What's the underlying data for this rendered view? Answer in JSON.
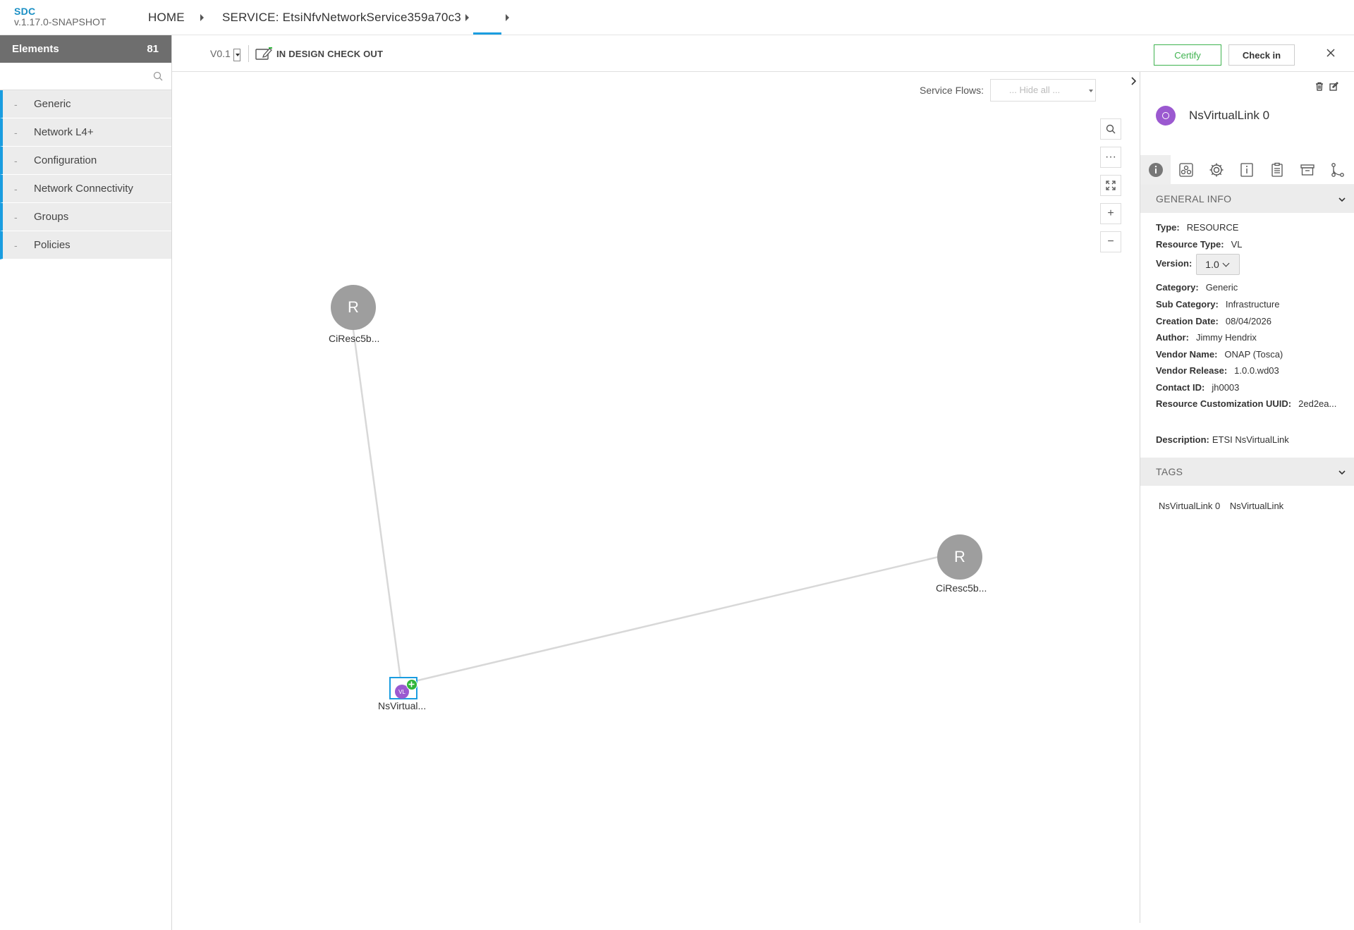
{
  "app": {
    "name": "SDC",
    "version": "v.1.17.0-SNAPSHOT"
  },
  "breadcrumb": {
    "home": "HOME",
    "service": "SERVICE: EtsiNfvNetworkService359a70c3"
  },
  "sidebar": {
    "title": "Elements",
    "count": "81",
    "search_placeholder": "",
    "items": [
      {
        "label": "Generic"
      },
      {
        "label": "Network L4+"
      },
      {
        "label": "Configuration"
      },
      {
        "label": "Network Connectivity"
      },
      {
        "label": "Groups"
      },
      {
        "label": "Policies"
      }
    ],
    "item_dash": "-"
  },
  "toolbar": {
    "version": "V0.1",
    "status": "IN DESIGN CHECK OUT",
    "certify_label": "Certify",
    "checkin_label": "Check in"
  },
  "canvas": {
    "service_flows_label": "Service Flows:",
    "service_flows_value": "... Hide all ...",
    "nodes": [
      {
        "label": "CiResc5b...",
        "glyph": "R"
      },
      {
        "label": "CiResc5b...",
        "glyph": "R"
      },
      {
        "label": "NsVirtual...",
        "glyph": "VL"
      }
    ],
    "zoom_icons": [
      "search-icon",
      "more-icon",
      "fit-icon",
      "zoom-in-icon",
      "zoom-out-icon"
    ],
    "zoom_glyphs": {
      "more": "···",
      "plus": "+",
      "minus": "−"
    }
  },
  "panel": {
    "title": "NsVirtualLink 0",
    "avatar_color": "#9b59d0",
    "general_info_title": "GENERAL INFO",
    "fields": {
      "type_label": "Type:",
      "type_value": "RESOURCE",
      "resource_type_label": "Resource Type:",
      "resource_type_value": "VL",
      "version_label": "Version:",
      "version_value": "1.0",
      "category_label": "Category:",
      "category_value": "Generic",
      "subcategory_label": "Sub Category:",
      "subcategory_value": "Infrastructure",
      "creation_date_label": "Creation Date:",
      "creation_date_value": "08/04/2026",
      "author_label": "Author:",
      "author_value": "Jimmy Hendrix",
      "vendor_name_label": "Vendor Name:",
      "vendor_name_value": "ONAP (Tosca)",
      "vendor_release_label": "Vendor Release:",
      "vendor_release_value": "1.0.0.wd03",
      "contact_label": "Contact ID:",
      "contact_value": "jh0003",
      "uuid_label": "Resource Customization UUID:",
      "uuid_value": "2ed2ea...",
      "description_label": "Description:",
      "description_value": "ETSI NsVirtualLink"
    },
    "tags_title": "TAGS",
    "tags": [
      "NsVirtualLink 0",
      "NsVirtualLink"
    ]
  },
  "colors": {
    "accent": "#1a9de0",
    "certify": "#3fb34f",
    "node_gray": "#9e9e9e",
    "vl_purple": "#9b59d0",
    "badge_green": "#2fb53a"
  }
}
